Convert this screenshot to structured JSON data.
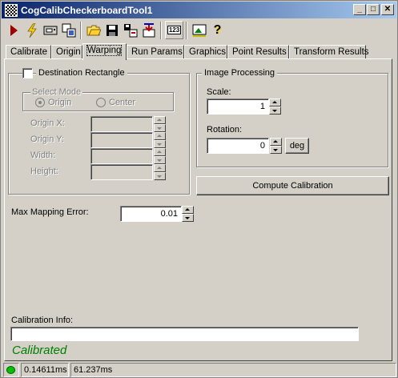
{
  "window": {
    "title": "CogCalibCheckerboardTool1"
  },
  "titlebar_buttons": {
    "minimize": "_",
    "maximize": "□",
    "close": "✕"
  },
  "toolbar": {
    "icons": [
      "run-icon",
      "lightning-icon",
      "camera-icon",
      "image-copy-icon",
      "open-folder-icon",
      "save-icon",
      "export-icon",
      "import-icon",
      "numeric-123-icon",
      "image-icon",
      "help-icon"
    ],
    "numeric_label": "123",
    "help_label": "?"
  },
  "tabs": [
    "Calibrate",
    "Origin",
    "Warping",
    "Run Params",
    "Graphics",
    "Point Results",
    "Transform Results"
  ],
  "active_tab": "Warping",
  "destination": {
    "checkbox_label": "Destination Rectangle",
    "select_mode_label": "Select Mode",
    "mode_origin": "Origin",
    "mode_center": "Center",
    "origin_x_label": "Origin X:",
    "origin_y_label": "Origin Y:",
    "width_label": "Width:",
    "height_label": "Height:"
  },
  "image_processing": {
    "title": "Image Processing",
    "scale_label": "Scale:",
    "scale_value": "1",
    "rotation_label": "Rotation:",
    "rotation_value": "0",
    "units_button": "deg"
  },
  "compute_button": "Compute Calibration",
  "max_error": {
    "label": "Max Mapping Error:",
    "value": "0.01"
  },
  "calib_info": {
    "label": "Calibration Info:",
    "value": ""
  },
  "status_text": "Calibrated",
  "statusbar": {
    "time1": "0.14611ms",
    "time2": "61.237ms"
  },
  "colors": {
    "status_ok": "#00c000",
    "calibrated_text": "#008000",
    "title_gradient_start": "#0a246a"
  }
}
